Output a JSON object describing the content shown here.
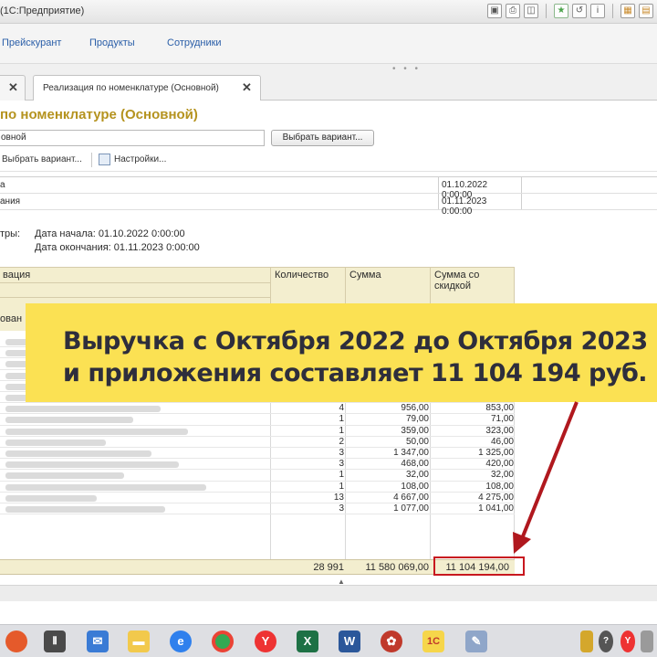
{
  "window": {
    "title": "(1С:Предприятие)"
  },
  "menu": {
    "items": [
      "Прейскурант",
      "Продукты",
      "Сотрудники"
    ]
  },
  "tabs": {
    "first_close": "✕",
    "active_label": "Реализация по номенклатуре (Основной)",
    "active_close": "✕",
    "dots": "• • •"
  },
  "report": {
    "title": "по номенклатуре (Основной)",
    "variant_value": "овной",
    "variant_button": "Выбрать вариант...",
    "cmd_choose": "Выбрать вариант...",
    "cmd_settings": "Настройки..."
  },
  "params": [
    {
      "label": "а",
      "value": "01.10.2022 0:00:00"
    },
    {
      "label": "ания",
      "value": "01.11.2023 0:00:00"
    }
  ],
  "filters": {
    "label": "тры:",
    "start": "Дата начала: 01.10.2022 0:00:00",
    "end": "Дата окончания: 01.11.2023 0:00:00"
  },
  "grid": {
    "headers": {
      "name": "вация",
      "qty": "Количество",
      "sum": "Сумма",
      "disc1": "Сумма со",
      "disc2": "скидкой",
      "group": "ован"
    },
    "rows": [
      {
        "qty": "4",
        "sum": "956,00",
        "disc": "853,00"
      },
      {
        "qty": "1",
        "sum": "79,00",
        "disc": "71,00"
      },
      {
        "qty": "1",
        "sum": "359,00",
        "disc": "323,00"
      },
      {
        "qty": "2",
        "sum": "50,00",
        "disc": "46,00"
      },
      {
        "qty": "3",
        "sum": "1 347,00",
        "disc": "1 325,00"
      },
      {
        "qty": "3",
        "sum": "468,00",
        "disc": "420,00"
      },
      {
        "qty": "1",
        "sum": "32,00",
        "disc": "32,00"
      },
      {
        "qty": "1",
        "sum": "108,00",
        "disc": "108,00"
      },
      {
        "qty": "13",
        "sum": "4 667,00",
        "disc": "4 275,00"
      },
      {
        "qty": "3",
        "sum": "1 077,00",
        "disc": "1 041,00"
      }
    ],
    "total": {
      "qty": "28 991",
      "sum": "11 580 069,00",
      "disc": "11 104 194,00"
    }
  },
  "overlay": {
    "line1": "Выручка с Октября 2022 до Октября 2023",
    "line2": "и приложения составляет 11 104 194 руб.",
    "background": "#fbe153",
    "arrow_color": "#b0181e"
  },
  "taskbar": {
    "icons": [
      "task-view-icon",
      "file-explorer-icon",
      "edge-icon",
      "chrome-icon",
      "yandex-icon",
      "excel-icon",
      "word-icon",
      "onec-icon",
      "paint-icon"
    ],
    "onec_label": "1С"
  }
}
